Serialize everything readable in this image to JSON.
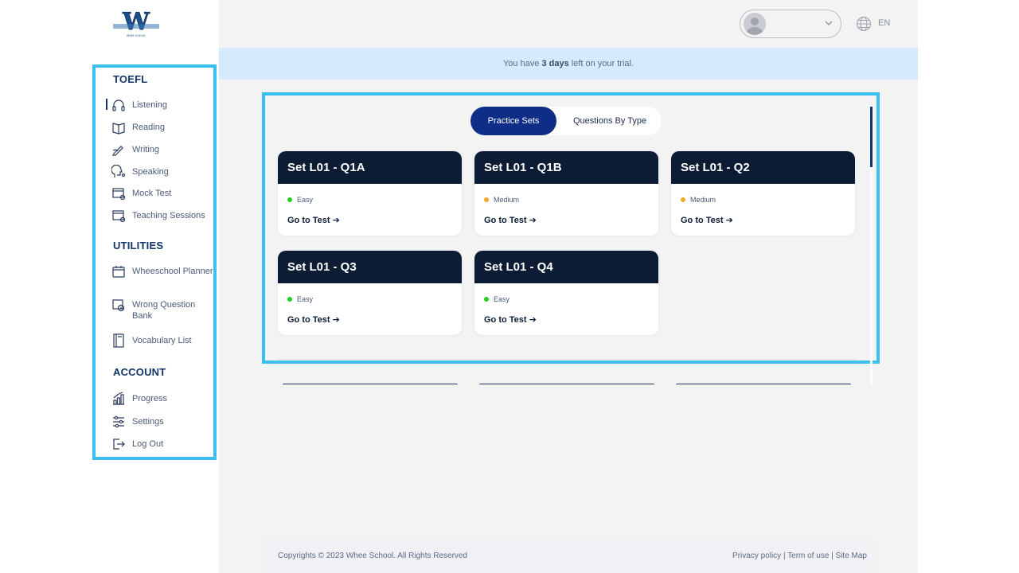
{
  "brand": {
    "logo_letter": "W",
    "logo_text": "WHEE SCHOOL"
  },
  "sidebar": {
    "sections": [
      {
        "title": "TOEFL"
      },
      {
        "title": "UTILITIES"
      },
      {
        "title": "ACCOUNT"
      }
    ],
    "items": [
      {
        "label": "Listening",
        "icon": "headphones-icon"
      },
      {
        "label": "Reading",
        "icon": "book-icon"
      },
      {
        "label": "Writing",
        "icon": "pen-icon"
      },
      {
        "label": "Speaking",
        "icon": "speaking-icon"
      },
      {
        "label": "Mock Test",
        "icon": "mock-test-icon"
      },
      {
        "label": "Teaching Sessions",
        "icon": "teaching-icon"
      },
      {
        "label": "Wheeschool Planner",
        "icon": "calendar-icon"
      },
      {
        "label": "Wrong Question Bank",
        "icon": "question-bank-icon"
      },
      {
        "label": "Vocabulary List",
        "icon": "notebook-icon"
      },
      {
        "label": "Progress",
        "icon": "chart-icon"
      },
      {
        "label": "Settings",
        "icon": "sliders-icon"
      },
      {
        "label": "Log Out",
        "icon": "logout-icon"
      }
    ]
  },
  "header": {
    "language": "EN"
  },
  "trial": {
    "prefix": "You have ",
    "days": "3 days",
    "suffix": " left on your trial."
  },
  "tabs": {
    "active": "Practice Sets",
    "inactive": "Questions By Type"
  },
  "cards": [
    {
      "title": "Set L01 - Q1A",
      "difficulty": "Easy",
      "color": "#1fd01f",
      "cta": "Go to Test"
    },
    {
      "title": "Set L01 - Q1B",
      "difficulty": "Medium",
      "color": "#f5a623",
      "cta": "Go to Test"
    },
    {
      "title": "Set L01 - Q2",
      "difficulty": "Medium",
      "color": "#f5a623",
      "cta": "Go to Test"
    },
    {
      "title": "Set L01 - Q3",
      "difficulty": "Easy",
      "color": "#1fd01f",
      "cta": "Go to Test"
    },
    {
      "title": "Set L01 - Q4",
      "difficulty": "Easy",
      "color": "#1fd01f",
      "cta": "Go to Test"
    }
  ],
  "footer": {
    "copyright": "Copyrights © 2023 Whee School. All Rights Reserved",
    "links": "Privacy policy | Term of use | Site Map"
  },
  "colors": {
    "navy": "#0c1c35",
    "accent": "#0d2d86",
    "highlight": "#3bbfef"
  }
}
